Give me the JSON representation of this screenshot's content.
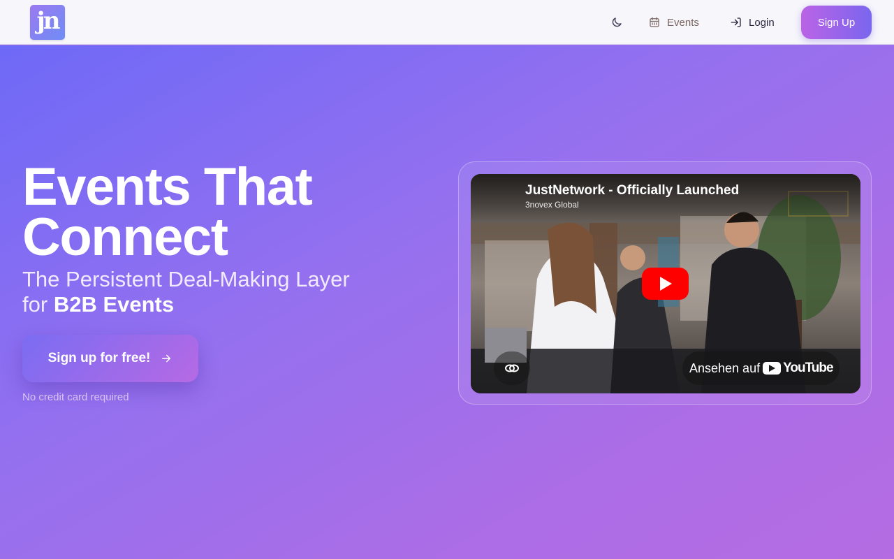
{
  "header": {
    "logo_text": "jn",
    "theme_toggle_icon": "moon-icon",
    "events_label": "Events",
    "login_label": "Login",
    "signup_label": "Sign Up"
  },
  "hero": {
    "title_line1": "Events That",
    "title_line2": "Connect",
    "subtitle_part1": "The Persistent Deal-Making Layer",
    "subtitle_for": "for",
    "subtitle_bold": "B2B Events",
    "cta_label": "Sign up for free!",
    "cta_note": "No credit card required"
  },
  "video": {
    "title": "JustNetwork - Officially Launched",
    "channel": "3novex Global",
    "watch_on": "Ansehen auf",
    "platform": "YouTube"
  },
  "colors": {
    "accent_start": "#bb63e6",
    "accent_end": "#7a66ee",
    "youtube_red": "#ff0000"
  }
}
